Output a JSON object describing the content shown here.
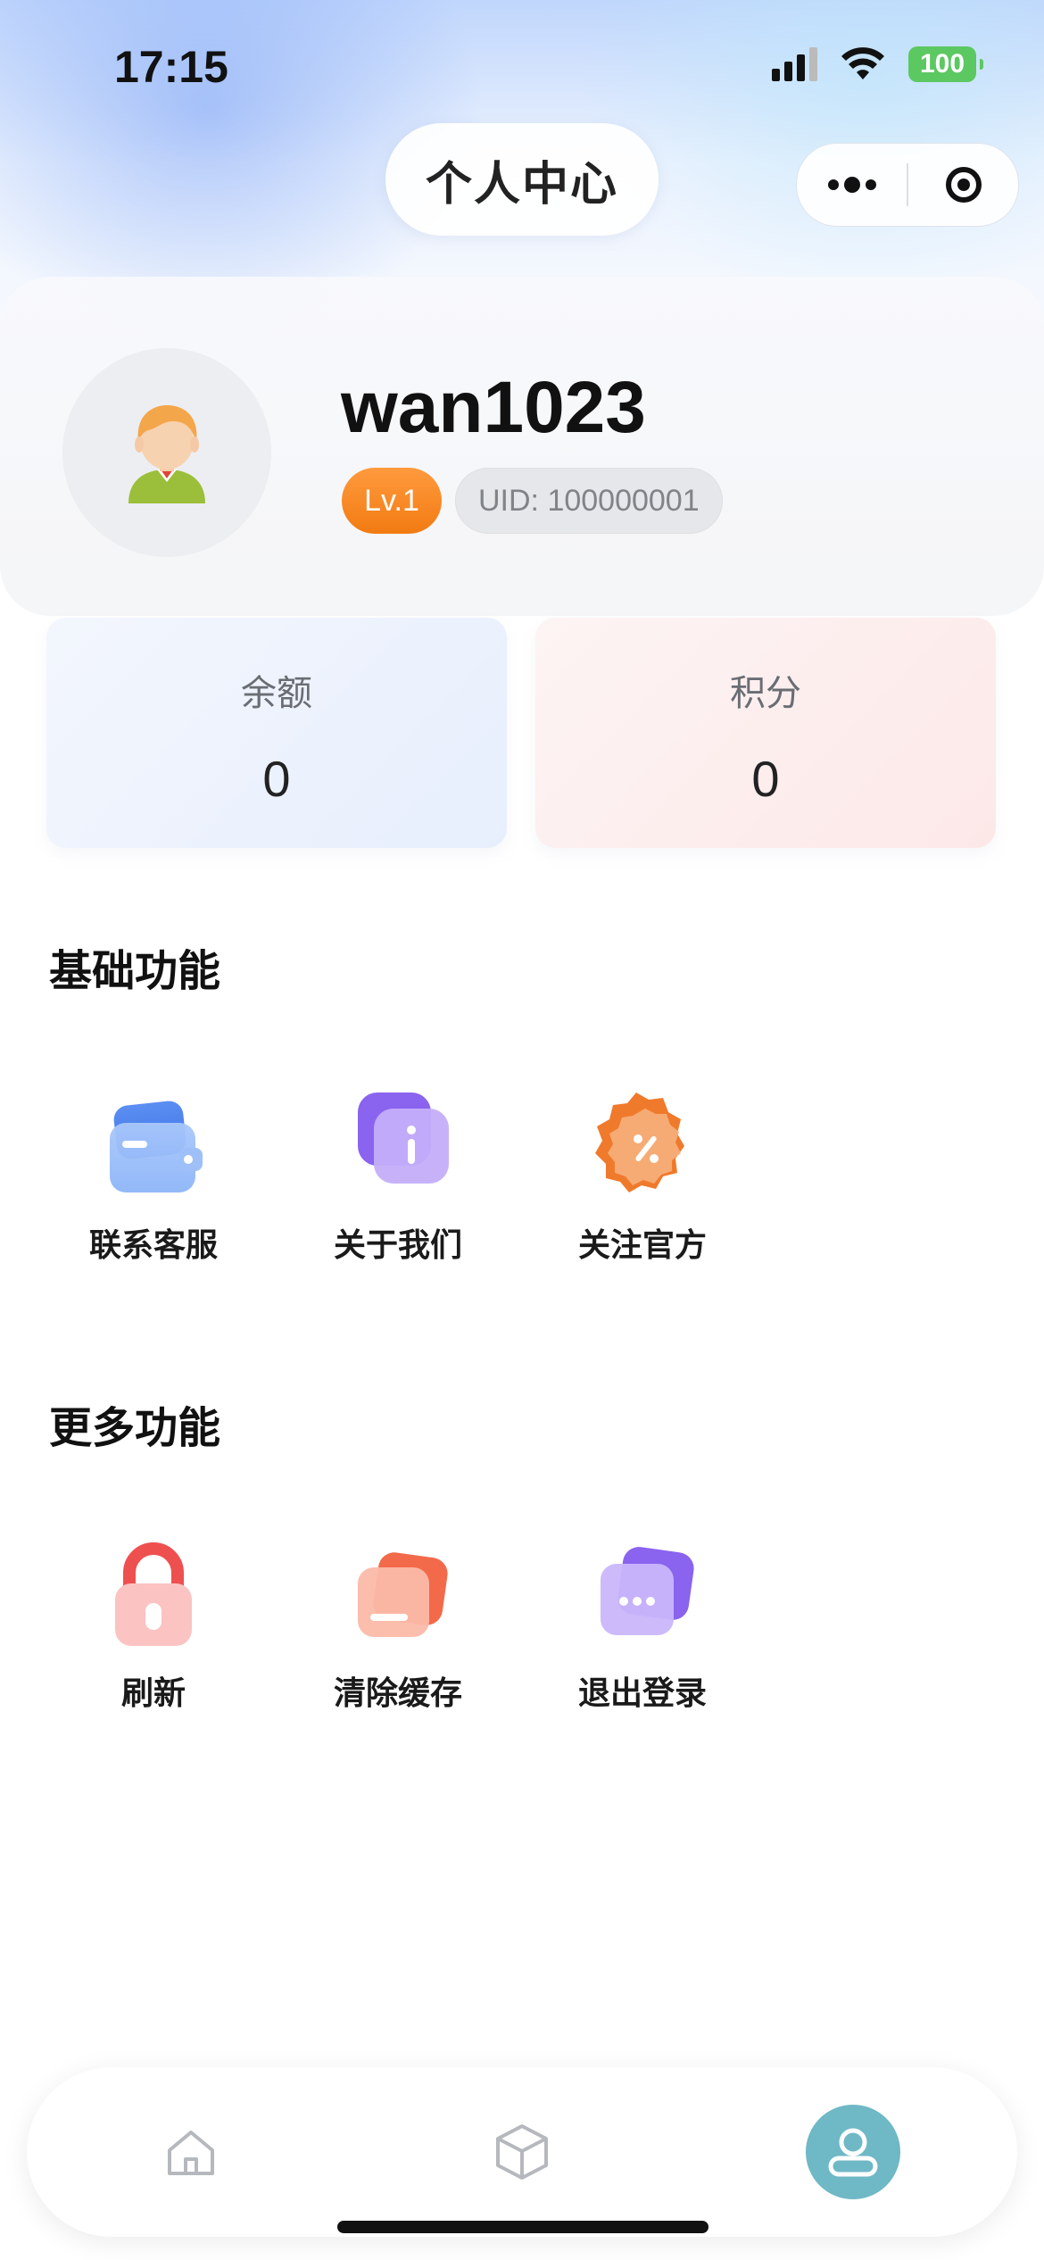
{
  "status_bar": {
    "time": "17:15",
    "battery": "100"
  },
  "header": {
    "title": "个人中心"
  },
  "profile": {
    "username": "wan1023",
    "level": "Lv.1",
    "uid": "UID: 100000001"
  },
  "stats": {
    "balance": {
      "label": "余额",
      "value": "0"
    },
    "points": {
      "label": "积分",
      "value": "0"
    }
  },
  "basic_section": {
    "title": "基础功能",
    "items": [
      {
        "label": "联系客服",
        "icon": "wallet-icon"
      },
      {
        "label": "关于我们",
        "icon": "info-icon"
      },
      {
        "label": "关注官方",
        "icon": "discount-badge-icon"
      }
    ]
  },
  "more_section": {
    "title": "更多功能",
    "items": [
      {
        "label": "刷新",
        "icon": "lock-icon"
      },
      {
        "label": "清除缓存",
        "icon": "stack-icon"
      },
      {
        "label": "退出登录",
        "icon": "chat-bubble-icon"
      }
    ]
  },
  "tabbar": {
    "tabs": [
      {
        "name": "home",
        "icon": "home-icon"
      },
      {
        "name": "product",
        "icon": "cube-icon"
      },
      {
        "name": "profile",
        "icon": "user-icon",
        "active": true
      }
    ],
    "active_color": "#6fb8c6"
  },
  "colors": {
    "level_badge": "#f27b12",
    "battery": "#5cc861"
  }
}
